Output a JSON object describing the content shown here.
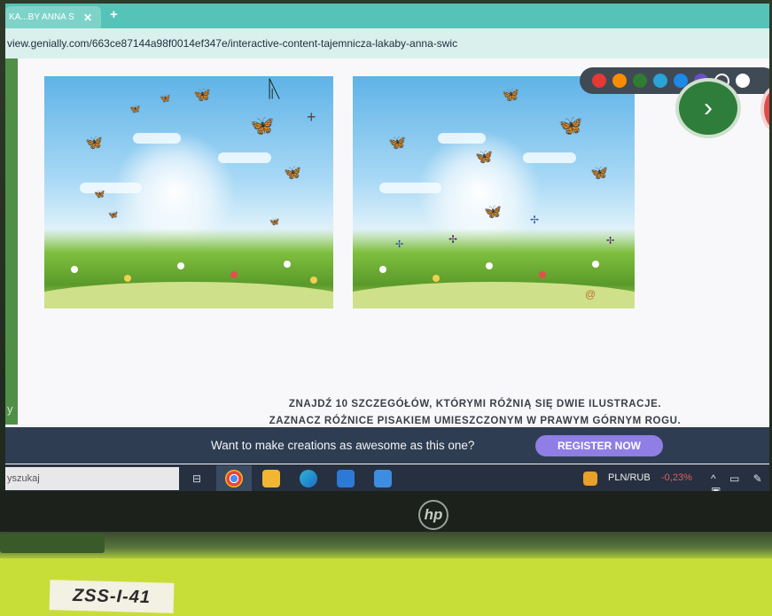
{
  "browser": {
    "tab_title": "KA...BY ANNA Ś",
    "tab_close": "✕",
    "new_tab": "+",
    "url": "view.genially.com/663ce87144a98f0014ef347e/interactive-content-tajemnicza-lakaby-anna-swic"
  },
  "pen_toolbar": {
    "colors": [
      "#e53935",
      "#fb8c00",
      "#2e7d32",
      "#29a3d8",
      "#1e88e5",
      "#6a4fc4",
      "outline",
      "#ffffff"
    ]
  },
  "navigation": {
    "next_icon": "chevron-right-icon",
    "next_glyph": "›"
  },
  "left_strip": {
    "letter": "y"
  },
  "instructions": {
    "line1": "ZNAJDŹ 10 SZCZEGÓŁÓW, KTÓRYMI RÓŻNIĄ SIĘ DWIE ILUSTRACJE.",
    "line2": "ZAZNACZ RÓŻNICE PISAKIEM UMIESZCZONYM W PRAWYM GÓRNYM ROGU."
  },
  "promo": {
    "text": "Want to make creations as awesome as this one?",
    "button": "REGISTER NOW"
  },
  "taskbar": {
    "search_placeholder": "yszukaj",
    "ticker_label": "PLN/RUB",
    "ticker_value": "-0,23%",
    "tray": "^ ▭ ✎ ▣"
  },
  "laptop": {
    "logo": "hp",
    "sticker": "ZSS-I-41"
  }
}
